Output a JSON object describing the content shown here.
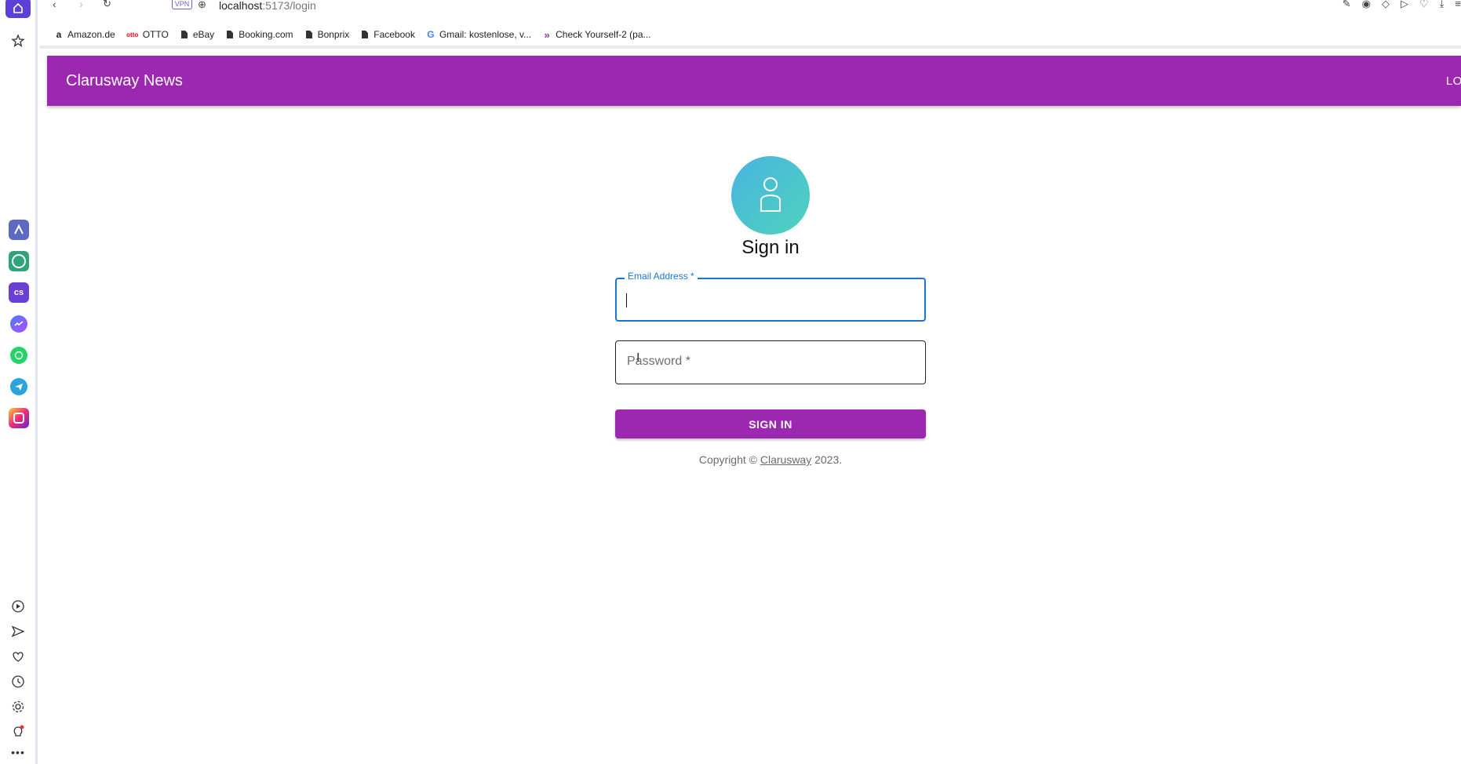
{
  "browser": {
    "url_host": "localhost",
    "url_path": ":5173/login",
    "vpn_label": "VPN",
    "bookmarks": [
      {
        "label": "Amazon.de",
        "icon": "amazon-icon"
      },
      {
        "label": "OTTO",
        "icon": "otto-icon"
      },
      {
        "label": "eBay",
        "icon": "page-icon"
      },
      {
        "label": "Booking.com",
        "icon": "page-icon"
      },
      {
        "label": "Bonprix",
        "icon": "page-icon"
      },
      {
        "label": "Facebook",
        "icon": "page-icon"
      },
      {
        "label": "Gmail: kostenlose, v...",
        "icon": "google-icon"
      },
      {
        "label": "Check Yourself-2 (pa...",
        "icon": "chevron-logo-icon"
      }
    ]
  },
  "app": {
    "brand": "Clarusway News",
    "nav_login": "LOGIN"
  },
  "form": {
    "title": "Sign in",
    "email_label": "Email Address *",
    "password_placeholder": "Password *",
    "submit_label": "SIGN IN",
    "copyright_prefix": "Copyright © ",
    "copyright_link": "Clarusway",
    "copyright_suffix": " 2023."
  },
  "colors": {
    "primary": "#9c27b0",
    "focus": "#1976d2",
    "avatar_gradient_start": "#47b4e0",
    "avatar_gradient_end": "#4fd3bc"
  }
}
